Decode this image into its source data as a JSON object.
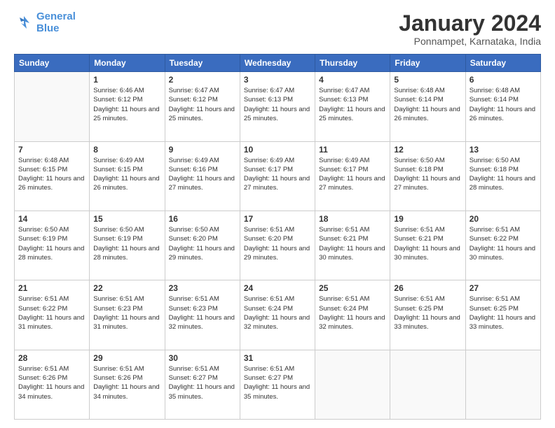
{
  "logo": {
    "text1": "General",
    "text2": "Blue"
  },
  "header": {
    "title": "January 2024",
    "subtitle": "Ponnampet, Karnataka, India"
  },
  "weekdays": [
    "Sunday",
    "Monday",
    "Tuesday",
    "Wednesday",
    "Thursday",
    "Friday",
    "Saturday"
  ],
  "weeks": [
    [
      {
        "day": "",
        "sunrise": "",
        "sunset": "",
        "daylight": ""
      },
      {
        "day": "1",
        "sunrise": "Sunrise: 6:46 AM",
        "sunset": "Sunset: 6:12 PM",
        "daylight": "Daylight: 11 hours and 25 minutes."
      },
      {
        "day": "2",
        "sunrise": "Sunrise: 6:47 AM",
        "sunset": "Sunset: 6:12 PM",
        "daylight": "Daylight: 11 hours and 25 minutes."
      },
      {
        "day": "3",
        "sunrise": "Sunrise: 6:47 AM",
        "sunset": "Sunset: 6:13 PM",
        "daylight": "Daylight: 11 hours and 25 minutes."
      },
      {
        "day": "4",
        "sunrise": "Sunrise: 6:47 AM",
        "sunset": "Sunset: 6:13 PM",
        "daylight": "Daylight: 11 hours and 25 minutes."
      },
      {
        "day": "5",
        "sunrise": "Sunrise: 6:48 AM",
        "sunset": "Sunset: 6:14 PM",
        "daylight": "Daylight: 11 hours and 26 minutes."
      },
      {
        "day": "6",
        "sunrise": "Sunrise: 6:48 AM",
        "sunset": "Sunset: 6:14 PM",
        "daylight": "Daylight: 11 hours and 26 minutes."
      }
    ],
    [
      {
        "day": "7",
        "sunrise": "Sunrise: 6:48 AM",
        "sunset": "Sunset: 6:15 PM",
        "daylight": "Daylight: 11 hours and 26 minutes."
      },
      {
        "day": "8",
        "sunrise": "Sunrise: 6:49 AM",
        "sunset": "Sunset: 6:15 PM",
        "daylight": "Daylight: 11 hours and 26 minutes."
      },
      {
        "day": "9",
        "sunrise": "Sunrise: 6:49 AM",
        "sunset": "Sunset: 6:16 PM",
        "daylight": "Daylight: 11 hours and 27 minutes."
      },
      {
        "day": "10",
        "sunrise": "Sunrise: 6:49 AM",
        "sunset": "Sunset: 6:17 PM",
        "daylight": "Daylight: 11 hours and 27 minutes."
      },
      {
        "day": "11",
        "sunrise": "Sunrise: 6:49 AM",
        "sunset": "Sunset: 6:17 PM",
        "daylight": "Daylight: 11 hours and 27 minutes."
      },
      {
        "day": "12",
        "sunrise": "Sunrise: 6:50 AM",
        "sunset": "Sunset: 6:18 PM",
        "daylight": "Daylight: 11 hours and 27 minutes."
      },
      {
        "day": "13",
        "sunrise": "Sunrise: 6:50 AM",
        "sunset": "Sunset: 6:18 PM",
        "daylight": "Daylight: 11 hours and 28 minutes."
      }
    ],
    [
      {
        "day": "14",
        "sunrise": "Sunrise: 6:50 AM",
        "sunset": "Sunset: 6:19 PM",
        "daylight": "Daylight: 11 hours and 28 minutes."
      },
      {
        "day": "15",
        "sunrise": "Sunrise: 6:50 AM",
        "sunset": "Sunset: 6:19 PM",
        "daylight": "Daylight: 11 hours and 28 minutes."
      },
      {
        "day": "16",
        "sunrise": "Sunrise: 6:50 AM",
        "sunset": "Sunset: 6:20 PM",
        "daylight": "Daylight: 11 hours and 29 minutes."
      },
      {
        "day": "17",
        "sunrise": "Sunrise: 6:51 AM",
        "sunset": "Sunset: 6:20 PM",
        "daylight": "Daylight: 11 hours and 29 minutes."
      },
      {
        "day": "18",
        "sunrise": "Sunrise: 6:51 AM",
        "sunset": "Sunset: 6:21 PM",
        "daylight": "Daylight: 11 hours and 30 minutes."
      },
      {
        "day": "19",
        "sunrise": "Sunrise: 6:51 AM",
        "sunset": "Sunset: 6:21 PM",
        "daylight": "Daylight: 11 hours and 30 minutes."
      },
      {
        "day": "20",
        "sunrise": "Sunrise: 6:51 AM",
        "sunset": "Sunset: 6:22 PM",
        "daylight": "Daylight: 11 hours and 30 minutes."
      }
    ],
    [
      {
        "day": "21",
        "sunrise": "Sunrise: 6:51 AM",
        "sunset": "Sunset: 6:22 PM",
        "daylight": "Daylight: 11 hours and 31 minutes."
      },
      {
        "day": "22",
        "sunrise": "Sunrise: 6:51 AM",
        "sunset": "Sunset: 6:23 PM",
        "daylight": "Daylight: 11 hours and 31 minutes."
      },
      {
        "day": "23",
        "sunrise": "Sunrise: 6:51 AM",
        "sunset": "Sunset: 6:23 PM",
        "daylight": "Daylight: 11 hours and 32 minutes."
      },
      {
        "day": "24",
        "sunrise": "Sunrise: 6:51 AM",
        "sunset": "Sunset: 6:24 PM",
        "daylight": "Daylight: 11 hours and 32 minutes."
      },
      {
        "day": "25",
        "sunrise": "Sunrise: 6:51 AM",
        "sunset": "Sunset: 6:24 PM",
        "daylight": "Daylight: 11 hours and 32 minutes."
      },
      {
        "day": "26",
        "sunrise": "Sunrise: 6:51 AM",
        "sunset": "Sunset: 6:25 PM",
        "daylight": "Daylight: 11 hours and 33 minutes."
      },
      {
        "day": "27",
        "sunrise": "Sunrise: 6:51 AM",
        "sunset": "Sunset: 6:25 PM",
        "daylight": "Daylight: 11 hours and 33 minutes."
      }
    ],
    [
      {
        "day": "28",
        "sunrise": "Sunrise: 6:51 AM",
        "sunset": "Sunset: 6:26 PM",
        "daylight": "Daylight: 11 hours and 34 minutes."
      },
      {
        "day": "29",
        "sunrise": "Sunrise: 6:51 AM",
        "sunset": "Sunset: 6:26 PM",
        "daylight": "Daylight: 11 hours and 34 minutes."
      },
      {
        "day": "30",
        "sunrise": "Sunrise: 6:51 AM",
        "sunset": "Sunset: 6:27 PM",
        "daylight": "Daylight: 11 hours and 35 minutes."
      },
      {
        "day": "31",
        "sunrise": "Sunrise: 6:51 AM",
        "sunset": "Sunset: 6:27 PM",
        "daylight": "Daylight: 11 hours and 35 minutes."
      },
      {
        "day": "",
        "sunrise": "",
        "sunset": "",
        "daylight": ""
      },
      {
        "day": "",
        "sunrise": "",
        "sunset": "",
        "daylight": ""
      },
      {
        "day": "",
        "sunrise": "",
        "sunset": "",
        "daylight": ""
      }
    ]
  ]
}
